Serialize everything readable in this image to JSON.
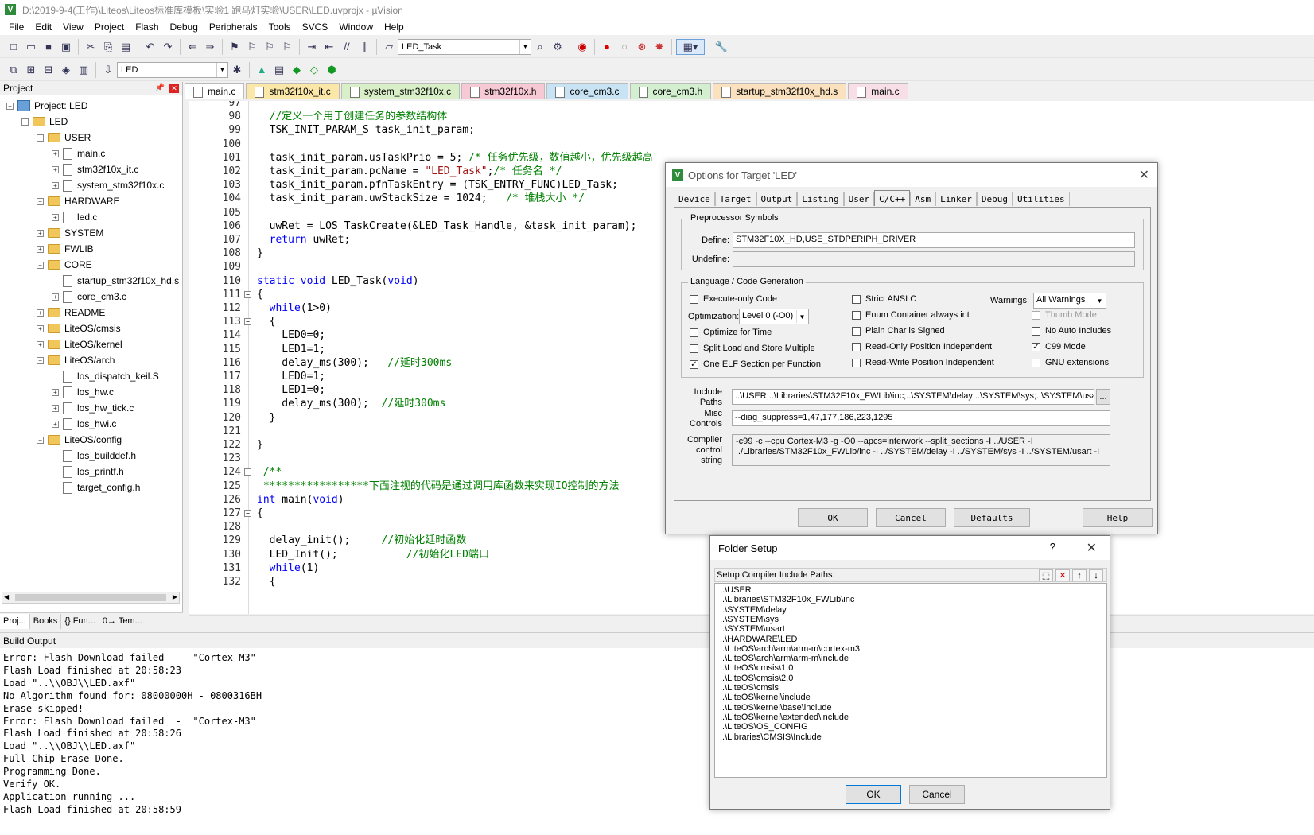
{
  "window": {
    "title": "D:\\2019-9-4(工作)\\Liteos\\Liteos标准库模板\\实验1 跑马灯实验\\USER\\LED.uvprojx - µVision",
    "app_icon": "V"
  },
  "menu": [
    "File",
    "Edit",
    "View",
    "Project",
    "Flash",
    "Debug",
    "Peripherals",
    "Tools",
    "SVCS",
    "Window",
    "Help"
  ],
  "toolbar": {
    "function_combo": "LED_Task",
    "target_combo": "LED"
  },
  "project_panel": {
    "title": "Project",
    "tree": [
      {
        "label": "Project: LED",
        "level": 0,
        "exp": "-",
        "kind": "project"
      },
      {
        "label": "LED",
        "level": 1,
        "exp": "-",
        "kind": "target"
      },
      {
        "label": "USER",
        "level": 2,
        "exp": "-",
        "kind": "folder"
      },
      {
        "label": "main.c",
        "level": 3,
        "exp": "+",
        "kind": "file"
      },
      {
        "label": "stm32f10x_it.c",
        "level": 3,
        "exp": "+",
        "kind": "file"
      },
      {
        "label": "system_stm32f10x.c",
        "level": 3,
        "exp": "+",
        "kind": "file"
      },
      {
        "label": "HARDWARE",
        "level": 2,
        "exp": "-",
        "kind": "folder"
      },
      {
        "label": "led.c",
        "level": 3,
        "exp": "+",
        "kind": "file"
      },
      {
        "label": "SYSTEM",
        "level": 2,
        "exp": "+",
        "kind": "folder"
      },
      {
        "label": "FWLIB",
        "level": 2,
        "exp": "+",
        "kind": "folder"
      },
      {
        "label": "CORE",
        "level": 2,
        "exp": "-",
        "kind": "folder"
      },
      {
        "label": "startup_stm32f10x_hd.s",
        "level": 3,
        "exp": "",
        "kind": "file"
      },
      {
        "label": "core_cm3.c",
        "level": 3,
        "exp": "+",
        "kind": "file"
      },
      {
        "label": "README",
        "level": 2,
        "exp": "+",
        "kind": "folder"
      },
      {
        "label": "LiteOS/cmsis",
        "level": 2,
        "exp": "+",
        "kind": "folder"
      },
      {
        "label": "LiteOS/kernel",
        "level": 2,
        "exp": "+",
        "kind": "folder"
      },
      {
        "label": "LiteOS/arch",
        "level": 2,
        "exp": "-",
        "kind": "folder"
      },
      {
        "label": "los_dispatch_keil.S",
        "level": 3,
        "exp": "",
        "kind": "file"
      },
      {
        "label": "los_hw.c",
        "level": 3,
        "exp": "+",
        "kind": "file"
      },
      {
        "label": "los_hw_tick.c",
        "level": 3,
        "exp": "+",
        "kind": "file"
      },
      {
        "label": "los_hwi.c",
        "level": 3,
        "exp": "+",
        "kind": "file"
      },
      {
        "label": "LiteOS/config",
        "level": 2,
        "exp": "-",
        "kind": "folder"
      },
      {
        "label": "los_builddef.h",
        "level": 3,
        "exp": "",
        "kind": "file"
      },
      {
        "label": "los_printf.h",
        "level": 3,
        "exp": "",
        "kind": "file"
      },
      {
        "label": "target_config.h",
        "level": 3,
        "exp": "",
        "kind": "file"
      }
    ],
    "tabs": [
      "Proj...",
      "Books",
      "{} Fun...",
      "0→ Tem..."
    ]
  },
  "editor_tabs": [
    {
      "label": "main.c",
      "color": "#ffffff",
      "active": true
    },
    {
      "label": "stm32f10x_it.c",
      "color": "#fbe7a8"
    },
    {
      "label": "system_stm32f10x.c",
      "color": "#d9efc7"
    },
    {
      "label": "stm32f10x.h",
      "color": "#f6c9d4"
    },
    {
      "label": "core_cm3.c",
      "color": "#c8e3f3"
    },
    {
      "label": "core_cm3.h",
      "color": "#d3efcf"
    },
    {
      "label": "startup_stm32f10x_hd.s",
      "color": "#fbe1bd"
    },
    {
      "label": "main.c",
      "color": "#f8dfe7"
    }
  ],
  "code_lines": [
    {
      "n": "97",
      "html": ""
    },
    {
      "n": "98",
      "html": "  <span class='cm'>//定义一个用于创建任务的参数结构体</span>"
    },
    {
      "n": "99",
      "html": "  TSK_INIT_PARAM_S task_init_param;"
    },
    {
      "n": "100",
      "html": ""
    },
    {
      "n": "101",
      "html": "  task_init_param.usTaskPrio = 5; <span class='cm'>/* 任务优先级，数值越小，优先级越高</span>"
    },
    {
      "n": "102",
      "html": "  task_init_param.pcName = <span class='st'>\"LED_Task\"</span>;<span class='cm'>/* 任务名 */</span>"
    },
    {
      "n": "103",
      "html": "  task_init_param.pfnTaskEntry = (TSK_ENTRY_FUNC)LED_Task;"
    },
    {
      "n": "104",
      "html": "  task_init_param.uwStackSize = 1024;   <span class='cm'>/* 堆栈大小 */</span>"
    },
    {
      "n": "105",
      "html": ""
    },
    {
      "n": "106",
      "html": "  uwRet = LOS_TaskCreate(&amp;LED_Task_Handle, &amp;task_init_param);"
    },
    {
      "n": "107",
      "html": "  <span class='kw'>return</span> uwRet;"
    },
    {
      "n": "108",
      "html": "}"
    },
    {
      "n": "109",
      "html": ""
    },
    {
      "n": "110",
      "html": "<span class='kw'>static</span> <span class='kw'>void</span> LED_Task(<span class='kw'>void</span>)"
    },
    {
      "n": "111",
      "html": "{",
      "fold": true
    },
    {
      "n": "112",
      "html": "  <span class='kw'>while</span>(1&gt;0)"
    },
    {
      "n": "113",
      "html": "  {",
      "fold": true
    },
    {
      "n": "114",
      "html": "    LED0=0;"
    },
    {
      "n": "115",
      "html": "    LED1=1;"
    },
    {
      "n": "116",
      "html": "    delay_ms(300);   <span class='cm'>//延时300ms</span>"
    },
    {
      "n": "117",
      "html": "    LED0=1;"
    },
    {
      "n": "118",
      "html": "    LED1=0;"
    },
    {
      "n": "119",
      "html": "    delay_ms(300);  <span class='cm'>//延时300ms</span>"
    },
    {
      "n": "120",
      "html": "  }"
    },
    {
      "n": "121",
      "html": ""
    },
    {
      "n": "122",
      "html": "}"
    },
    {
      "n": "123",
      "html": ""
    },
    {
      "n": "124",
      "html": " <span class='cm'>/**</span>",
      "fold": true
    },
    {
      "n": "125",
      "html": " <span class='cm'>*****************下面注视的代码是通过调用库函数来实现IO控制的方法</span>"
    },
    {
      "n": "126",
      "html": "<span class='kw'>int</span> main(<span class='kw'>void</span>)"
    },
    {
      "n": "127",
      "html": "{",
      "fold": true
    },
    {
      "n": "128",
      "html": ""
    },
    {
      "n": "129",
      "html": "  delay_init();     <span class='cm'>//初始化延时函数</span>"
    },
    {
      "n": "130",
      "html": "  LED_Init();           <span class='cm'>//初始化LED端口</span>"
    },
    {
      "n": "131",
      "html": "  <span class='kw'>while</span>(1)"
    },
    {
      "n": "132",
      "html": "  {"
    }
  ],
  "build_output": {
    "title": "Build Output",
    "lines": [
      "Error: Flash Download failed  -  \"Cortex-M3\"",
      "Flash Load finished at 20:58:23",
      "Load \"..\\\\OBJ\\\\LED.axf\"",
      "No Algorithm found for: 08000000H - 0800316BH",
      "Erase skipped!",
      "Error: Flash Download failed  -  \"Cortex-M3\"",
      "Flash Load finished at 20:58:26",
      "Load \"..\\\\OBJ\\\\LED.axf\"",
      "Full Chip Erase Done.",
      "Programming Done.",
      "Verify OK.",
      "Application running ...",
      "Flash Load finished at 20:58:59"
    ]
  },
  "options_dialog": {
    "title": "Options for Target 'LED'",
    "tabs": [
      "Device",
      "Target",
      "Output",
      "Listing",
      "User",
      "C/C++",
      "Asm",
      "Linker",
      "Debug",
      "Utilities"
    ],
    "active_tab": "C/C++",
    "preprocessor": {
      "group": "Preprocessor Symbols",
      "define_label": "Define:",
      "define_value": "STM32F10X_HD,USE_STDPERIPH_DRIVER",
      "undefine_label": "Undefine:",
      "undefine_value": ""
    },
    "language": {
      "group": "Language / Code Generation",
      "execute_only": "Execute-only Code",
      "optimization_label": "Optimization:",
      "optimization_value": "Level 0 (-O0)",
      "optimize_time": "Optimize for Time",
      "split_load": "Split Load and Store Multiple",
      "one_elf": "One ELF Section per Function",
      "strict_ansi": "Strict ANSI C",
      "enum_container": "Enum Container always int",
      "plain_char": "Plain Char is Signed",
      "ro_pi": "Read-Only Position Independent",
      "rw_pi": "Read-Write Position Independent",
      "warnings_label": "Warnings:",
      "warnings_value": "All Warnings",
      "thumb_mode": "Thumb Mode",
      "no_auto_includes": "No Auto Includes",
      "c99_mode": "C99 Mode",
      "gnu_ext": "GNU extensions"
    },
    "include_label_1": "Include",
    "include_label_2": "Paths",
    "include_value": "..\\USER;..\\Libraries\\STM32F10x_FWLib\\inc;..\\SYSTEM\\delay;..\\SYSTEM\\sys;..\\SYSTEM\\usart;..\\",
    "misc_label_1": "Misc",
    "misc_label_2": "Controls",
    "misc_value": "--diag_suppress=1,47,177,186,223,1295",
    "compiler_label_1": "Compiler",
    "compiler_label_2": "control",
    "compiler_label_3": "string",
    "compiler_line_1": "-c99 -c --cpu Cortex-M3 -g -O0 --apcs=interwork --split_sections -I ../USER -I",
    "compiler_line_2": "../Libraries/STM32F10x_FWLib/inc -I ../SYSTEM/delay -I ../SYSTEM/sys -I ../SYSTEM/usart -I",
    "browse": "...",
    "buttons": {
      "ok": "OK",
      "cancel": "Cancel",
      "defaults": "Defaults",
      "help": "Help"
    }
  },
  "folder_dialog": {
    "title": "Folder Setup",
    "help": "?",
    "list_title": "Setup Compiler Include Paths:",
    "paths": [
      "..\\USER",
      "..\\Libraries\\STM32F10x_FWLib\\inc",
      "..\\SYSTEM\\delay",
      "..\\SYSTEM\\sys",
      "..\\SYSTEM\\usart",
      "..\\HARDWARE\\LED",
      "..\\LiteOS\\arch\\arm\\arm-m\\cortex-m3",
      "..\\LiteOS\\arch\\arm\\arm-m\\include",
      "..\\LiteOS\\cmsis\\1.0",
      "..\\LiteOS\\cmsis\\2.0",
      "..\\LiteOS\\cmsis",
      "..\\LiteOS\\kernel\\include",
      "..\\LiteOS\\kernel\\base\\include",
      "..\\LiteOS\\kernel\\extended\\include",
      "..\\LiteOS\\OS_CONFIG",
      "..\\Libraries\\CMSIS\\Include"
    ],
    "ok": "OK",
    "cancel": "Cancel"
  }
}
